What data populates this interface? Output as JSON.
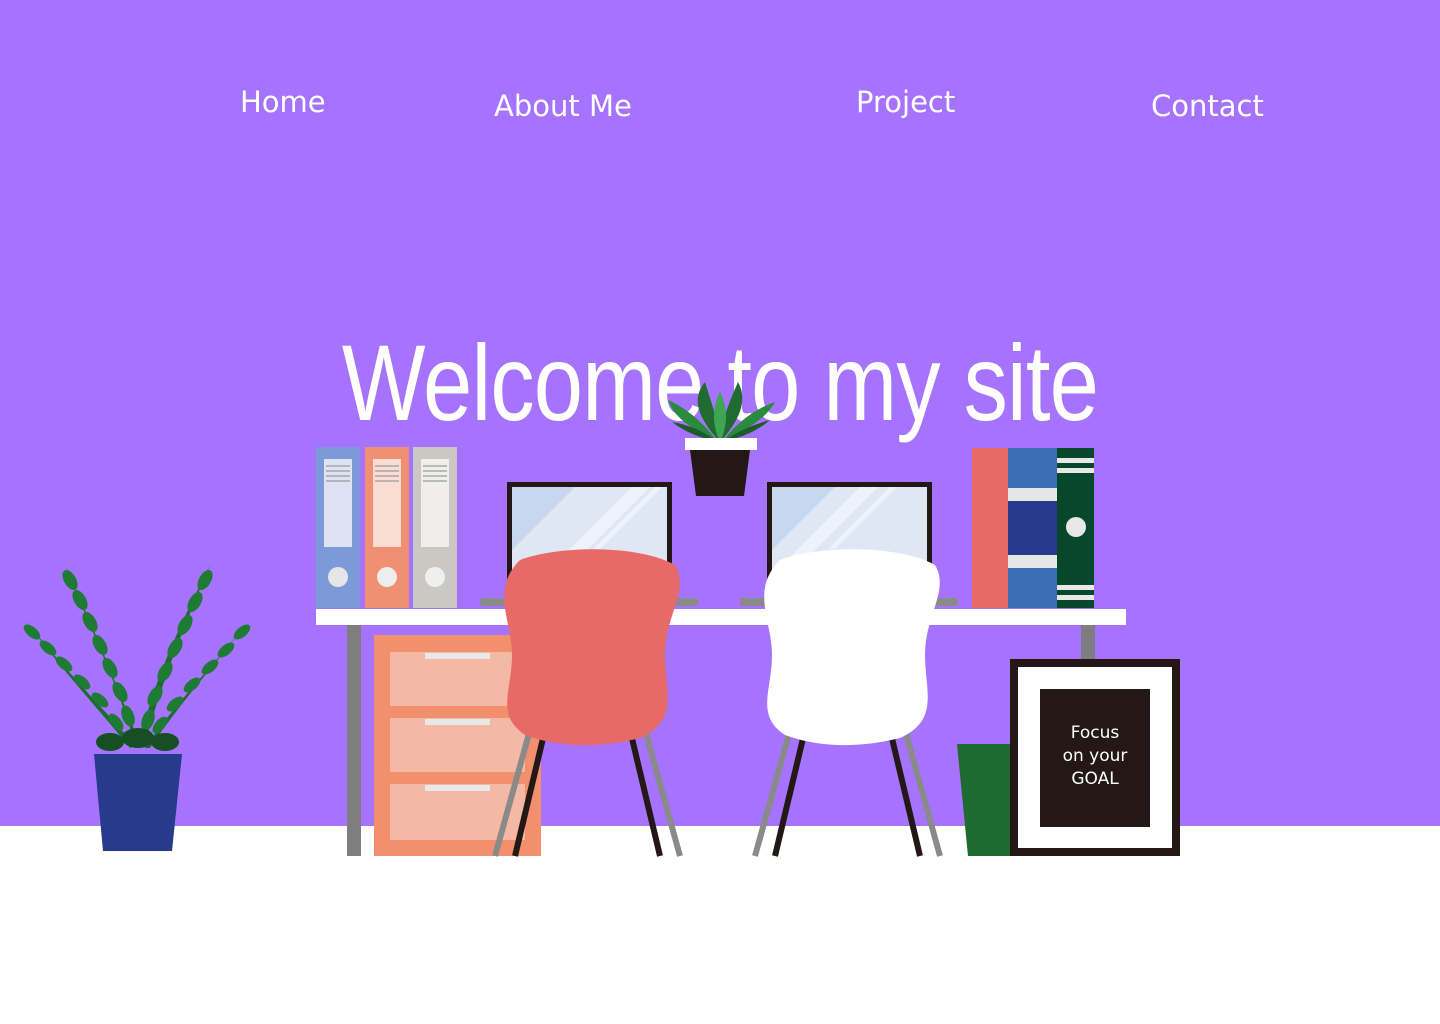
{
  "nav": {
    "items": [
      {
        "label": "Home"
      },
      {
        "label": "About Me"
      },
      {
        "label": "Project"
      },
      {
        "label": "Contact"
      }
    ]
  },
  "hero": {
    "title": "Welcome to my site"
  },
  "poster": {
    "lines": [
      "Focus",
      "on your",
      "GOAL"
    ]
  },
  "colors": {
    "background": "#a573fd",
    "floor": "#ffffff",
    "text": "#ffffff",
    "chair_left": "#e86a68",
    "chair_right": "#ffffff",
    "cabinet": "#f2906e"
  }
}
